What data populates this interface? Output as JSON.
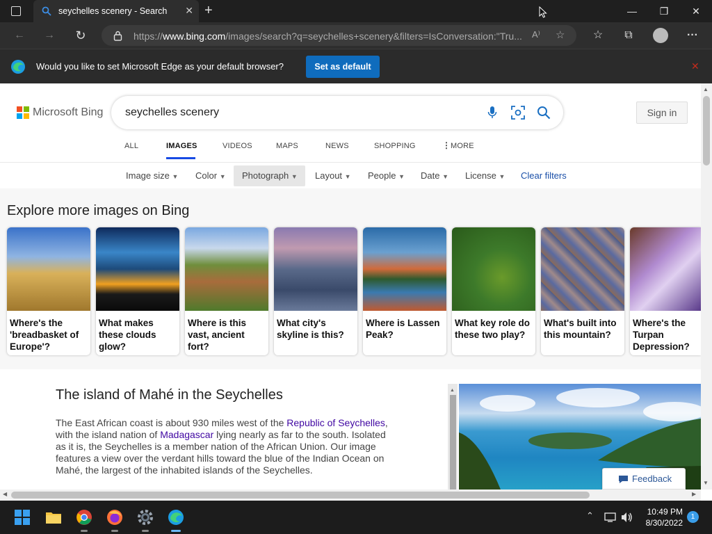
{
  "browser": {
    "tab_title": "seychelles scenery - Search",
    "url_prefix": "https://",
    "url_domain": "www.bing.com",
    "url_rest": "/images/search?q=seychelles+scenery&filters=IsConversation:\"Tru...",
    "infobar_message": "Would you like to set Microsoft Edge as your default browser?",
    "set_default_label": "Set as default"
  },
  "bing": {
    "logo_text": "Microsoft Bing",
    "search_value": "seychelles scenery",
    "sign_in_label": "Sign in",
    "nav": [
      "ALL",
      "IMAGES",
      "VIDEOS",
      "MAPS",
      "NEWS",
      "SHOPPING",
      "MORE"
    ],
    "filters": [
      "Image size",
      "Color",
      "Photograph",
      "Layout",
      "People",
      "Date",
      "License"
    ],
    "clear_filters": "Clear filters",
    "explore_heading": "Explore more images on Bing",
    "cards": [
      "Where's the 'breadbasket of Europe'?",
      "What makes these clouds glow?",
      "Where is this vast, ancient fort?",
      "What city's skyline is this?",
      "Where is Lassen Peak?",
      "What key role do these two play?",
      "What's built into this mountain?",
      "Where's the Turpan Depression?"
    ],
    "article_title": "The island of Mahé in the Seychelles",
    "article_t1": "The East African coast is about 930 miles west of the ",
    "article_link1": "Republic of Seychelles",
    "article_t2": ", with the island nation of ",
    "article_link2": "Madagascar",
    "article_t3": " lying nearly as far to the south. Isolated as it is, the Seychelles is a member nation of the African Union. Our image features a view over the verdant hills toward the blue of the Indian Ocean on Mahé, the largest of the inhabited islands of the Seychelles.",
    "feedback_label": "Feedback"
  },
  "taskbar": {
    "time": "10:49 PM",
    "date": "8/30/2022",
    "notification_count": "1"
  },
  "colors": {
    "accent": "#0f6cbd",
    "bing_link": "#4007a2",
    "chrome_dark": "#1f1f1f"
  }
}
